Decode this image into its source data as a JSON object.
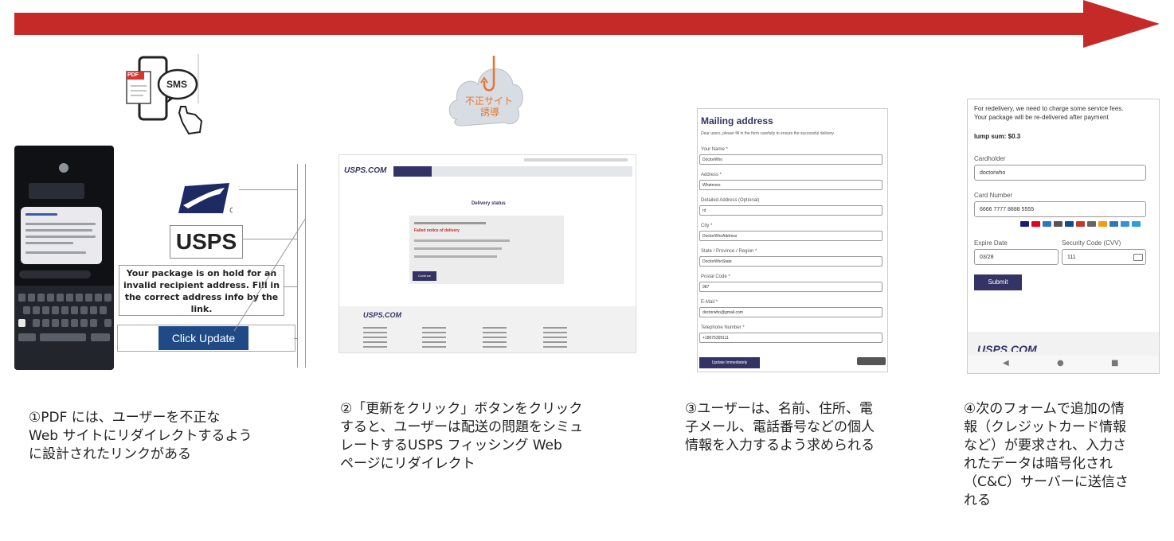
{
  "arrow": {
    "color": "#c62a28"
  },
  "icons": {
    "sms": {
      "pdf_label": "PDF",
      "sms_label": "SMS"
    },
    "cloud": {
      "label_line1": "不正サイト",
      "label_line2": "誘導"
    }
  },
  "step1": {
    "logo_text": "USPS",
    "message": "Your package is on hold for an invalid recipient address. Fill in the correct address info by the link.",
    "button_label": "Click Update",
    "caption_lines": [
      "①PDF には、ユーザーを不正な",
      "Web サイトにリダイレクトするよう",
      "に設計されたリンクがある"
    ]
  },
  "step2": {
    "site_logo": "USPS.COM",
    "page_title": "Delivery status",
    "card_title": "Failed notice of delivery",
    "card_button": "Continue",
    "caption_lines": [
      "②「更新をクリック」ボタンをクリック",
      "すると、ユーザーは配送の問題をシミュ",
      "レートするUSPS フィッシング Web",
      "ページにリダイレクト"
    ]
  },
  "step3": {
    "form_title": "Mailing address",
    "intro": "Dear users, please fill in the form carefully to ensure the successful delivery.",
    "fields": [
      {
        "label": "Your Name *",
        "value": "DoctorWho"
      },
      {
        "label": "Address *",
        "value": "Whatnoes"
      },
      {
        "label": "Detailed Address (Optional)",
        "value": "rd"
      },
      {
        "label": "City *",
        "value": "DoctorWhoAddress"
      },
      {
        "label": "State / Province / Region *",
        "value": "DoctorWhoState"
      },
      {
        "label": "Postal Code *",
        "value": "987"
      },
      {
        "label": "E-Mail *",
        "value": "doctorwho@gmail.com"
      },
      {
        "label": "Telephone Number *",
        "value": "+18675309111"
      }
    ],
    "button_label": "Update Immediately",
    "caption_lines": [
      "③ユーザーは、名前、住所、電",
      "子メール、電話番号などの個人",
      "情報を入力するよう求められる"
    ]
  },
  "step4": {
    "intro_line1": "For redelivery, we need to charge some service fees.",
    "intro_line2": "Your package will be re-delivered after payment",
    "amount": "lump sum: $0.3",
    "cardholder_label": "Cardholder",
    "cardholder_value": "doctorwho",
    "card_number_label": "Card Number",
    "card_number_value": "6666 7777 8888 5555",
    "expire_label": "Expire Date",
    "expire_value": "03/28",
    "cvv_label": "Security Code (CVV)",
    "cvv_value": "111",
    "button_label": "Submit",
    "footer_logo": "USPS.COM",
    "caption_lines": [
      "④次のフォームで追加の情",
      "報（クレジットカード情報",
      "など）が要求され、入力さ",
      "れたデータは暗号化され",
      "（C&C）サーバーに送信さ",
      "れる"
    ]
  }
}
